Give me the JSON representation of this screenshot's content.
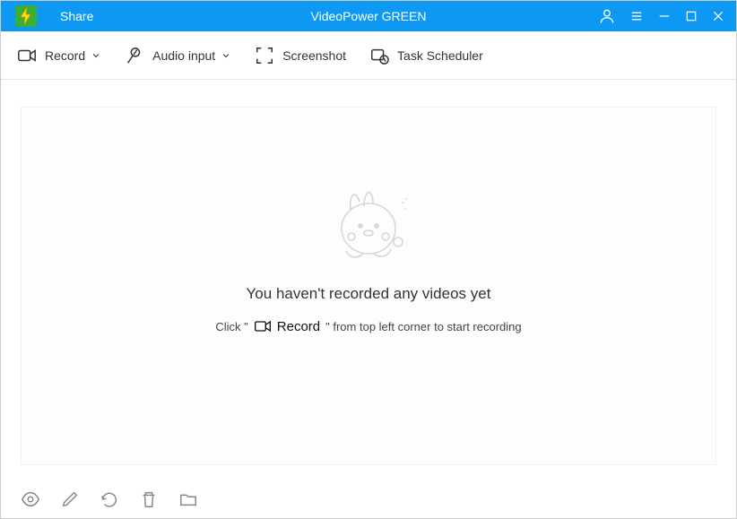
{
  "titlebar": {
    "share_label": "Share",
    "app_title": "VideoPower GREEN"
  },
  "toolbar": {
    "record_label": "Record",
    "audio_input_label": "Audio input",
    "screenshot_label": "Screenshot",
    "task_scheduler_label": "Task Scheduler"
  },
  "empty": {
    "heading": "You haven't recorded any videos yet",
    "hint_prefix": "Click  \"",
    "hint_record": "Record",
    "hint_suffix": "\"  from top left corner to start recording"
  }
}
